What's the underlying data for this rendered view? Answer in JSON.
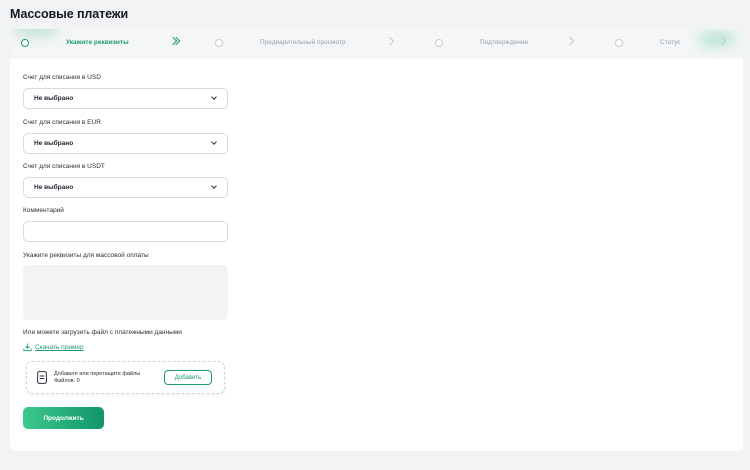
{
  "page": {
    "title": "Массовые платежи"
  },
  "stepper": {
    "steps": [
      {
        "label": "Укажите реквизиты",
        "active": true
      },
      {
        "label": "Предварительный просмотр",
        "active": false
      },
      {
        "label": "Подтверждение",
        "active": false
      },
      {
        "label": "Статус",
        "active": false
      }
    ]
  },
  "form": {
    "usd_account": {
      "label": "Счет для списания в USD",
      "value": "Не выбрано"
    },
    "eur_account": {
      "label": "Счет для списания в EUR",
      "value": "Не выбрано"
    },
    "usdt_account": {
      "label": "Счет для списания в USDT",
      "value": "Не выбрано"
    },
    "comment": {
      "label": "Комментарий",
      "value": ""
    },
    "details": {
      "label": "Укажите реквизиты для массовой оплаты",
      "value": ""
    },
    "upload_hint": "Или можете загрузить файл с платежными данными",
    "download_example": "Скачать пример",
    "dropzone": {
      "text": "Добавьте или перетащите файлы",
      "count": "Файлов: 0",
      "add_label": "Добавить"
    },
    "submit_label": "Продолжить"
  },
  "colors": {
    "accent": "#1f9b6e",
    "button_gradient_start": "#3cc98e",
    "button_gradient_end": "#129469",
    "background": "#f2f3f5"
  }
}
